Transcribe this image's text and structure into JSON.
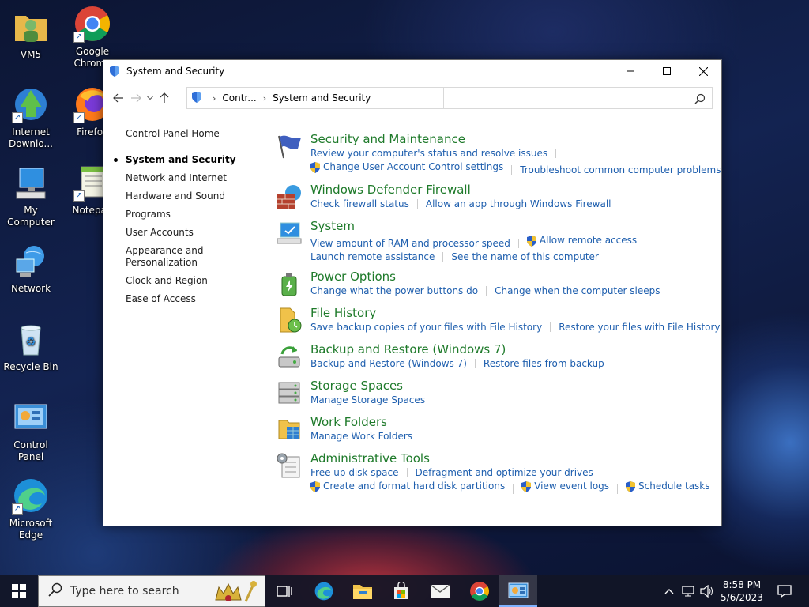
{
  "desktop": {
    "icons": [
      {
        "label": "VM5"
      },
      {
        "label": "Google Chrome"
      },
      {
        "label": "Internet Downlo..."
      },
      {
        "label": "Firefox"
      },
      {
        "label": "My Computer"
      },
      {
        "label": "Notepad"
      },
      {
        "label": "Network"
      },
      {
        "label": "Recycle Bin"
      },
      {
        "label": "Control Panel"
      },
      {
        "label": "Microsoft Edge"
      }
    ]
  },
  "window": {
    "title": "System and Security",
    "breadcrumb": [
      "Contr...",
      "System and Security"
    ],
    "search_placeholder": "",
    "search_value": ""
  },
  "leftnav": {
    "home": "Control Panel Home",
    "items": [
      {
        "label": "System and Security"
      },
      {
        "label": "Network and Internet"
      },
      {
        "label": "Hardware and Sound"
      },
      {
        "label": "Programs"
      },
      {
        "label": "User Accounts"
      },
      {
        "label": "Appearance and Personalization"
      },
      {
        "label": "Clock and Region"
      },
      {
        "label": "Ease of Access"
      }
    ]
  },
  "categories": [
    {
      "title": "Security and Maintenance",
      "icon": "flag-icon",
      "lines": [
        [
          "Review your computer's status and resolve issues"
        ],
        [
          "Change User Account Control settings",
          "Troubleshoot common computer problems"
        ]
      ]
    },
    {
      "title": "Windows Defender Firewall",
      "icon": "firewall-icon",
      "lines": [
        [
          "Check firewall status",
          "Allow an app through Windows Firewall"
        ]
      ]
    },
    {
      "title": "System",
      "icon": "computer-icon",
      "lines": [
        [
          "View amount of RAM and processor speed",
          "Allow remote access"
        ],
        [
          "Launch remote assistance",
          "See the name of this computer"
        ]
      ]
    },
    {
      "title": "Power Options",
      "icon": "battery-icon",
      "lines": [
        [
          "Change what the power buttons do",
          "Change when the computer sleeps"
        ]
      ]
    },
    {
      "title": "File History",
      "icon": "file-history-icon",
      "lines": [
        [
          "Save backup copies of your files with File History",
          "Restore your files with File History"
        ]
      ]
    },
    {
      "title": "Backup and Restore (Windows 7)",
      "icon": "backup-icon",
      "lines": [
        [
          "Backup and Restore (Windows 7)",
          "Restore files from backup"
        ]
      ]
    },
    {
      "title": "Storage Spaces",
      "icon": "storage-icon",
      "lines": [
        [
          "Manage Storage Spaces"
        ]
      ]
    },
    {
      "title": "Work Folders",
      "icon": "work-folders-icon",
      "lines": [
        [
          "Manage Work Folders"
        ]
      ]
    },
    {
      "title": "Administrative Tools",
      "icon": "admin-tools-icon",
      "lines": [
        [
          "Free up disk space",
          "Defragment and optimize your drives"
        ],
        [
          "Create and format hard disk partitions",
          "View event logs",
          "Schedule tasks"
        ]
      ]
    }
  ],
  "taskbar": {
    "search_placeholder": "Type here to search",
    "time": "8:58 PM",
    "date": "5/6/2023"
  }
}
